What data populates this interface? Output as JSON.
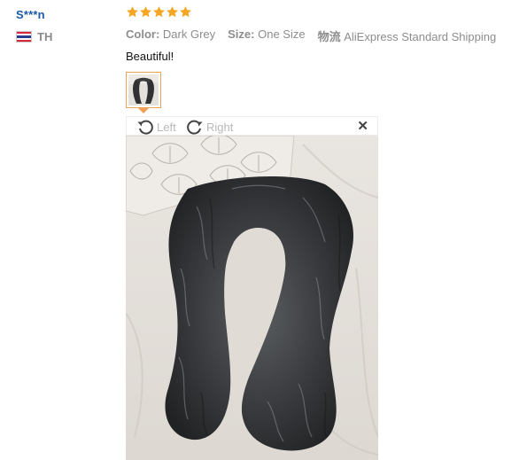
{
  "reviewer": {
    "name": "S***n",
    "country_code": "TH",
    "flag_icon": "thailand-flag-icon"
  },
  "review": {
    "rating": 5,
    "rating_max": 5,
    "star_color": "#f5a623",
    "color_label": "Color:",
    "color_value": "Dark Grey",
    "size_label": "Size:",
    "size_value": "One Size",
    "logistics_label": "物流",
    "logistics_value": "AliExpress Standard Shipping",
    "text": "Beautiful!"
  },
  "viewer": {
    "rotate_left_label": "Left",
    "rotate_right_label": "Right",
    "close_label": "✕",
    "accent_color": "#f3a056"
  }
}
